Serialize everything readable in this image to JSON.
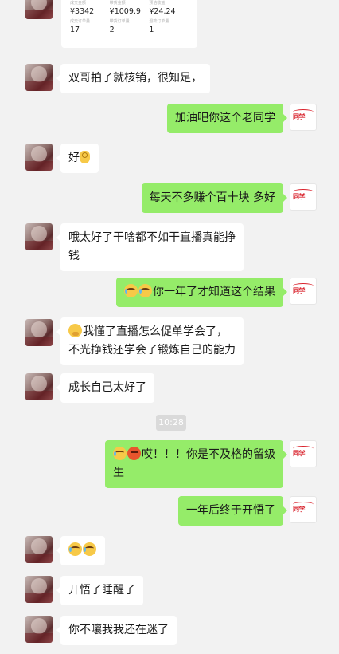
{
  "order_card": {
    "labels": [
      "成交金额",
      "带货金额",
      "预估收益"
    ],
    "values_top": [
      "¥3342",
      "¥1009.9",
      "¥24.24"
    ],
    "labels2": [
      "成交订单量",
      "带货订单量",
      "退款订单量"
    ],
    "values_bottom": [
      "17",
      "2",
      "1"
    ]
  },
  "messages": [
    {
      "side": "in",
      "lines": [
        "双哥拍了就核销，很知足，"
      ]
    },
    {
      "side": "out",
      "lines": [
        "加油吧你这个老同学"
      ]
    },
    {
      "side": "in",
      "lines": [
        "好"
      ],
      "emoji_after": "ok-hand-icon"
    },
    {
      "side": "out",
      "lines": [
        "每天不多赚个百十块 多好"
      ]
    },
    {
      "side": "in",
      "lines": [
        "哦太好了干啥都不如干直播真能挣",
        "钱"
      ]
    },
    {
      "side": "out",
      "lines": [
        "你一年了才知道这个结果"
      ],
      "emoji_before": [
        "laugh-cry-icon",
        "laugh-cry-icon"
      ]
    },
    {
      "side": "in",
      "lines": [
        "我懂了直播怎么促单学会了，",
        "不光挣钱还学会了锻炼自己的能力"
      ],
      "emoji_before": [
        "thinking-icon"
      ]
    },
    {
      "side": "in",
      "lines": [
        "成长自己太好了"
      ]
    },
    {
      "side": "time",
      "text": "10:28"
    },
    {
      "side": "out",
      "lines": [
        "哎！！！你是不及格的留级",
        "生"
      ],
      "emoji_before": [
        "laugh-cry-icon",
        "angry-icon"
      ]
    },
    {
      "side": "out",
      "lines": [
        "一年后终于开悟了"
      ]
    },
    {
      "side": "in",
      "lines": [
        ""
      ],
      "emoji_before": [
        "laugh-cry-icon",
        "laugh-cry-icon"
      ]
    },
    {
      "side": "in",
      "lines": [
        "开悟了睡醒了"
      ]
    },
    {
      "side": "in",
      "lines": [
        "你不嚷我我还在迷了"
      ]
    }
  ],
  "contact_avatar": {
    "logo_text": "同学"
  },
  "colors": {
    "background": "#f2f2f2",
    "outgoing_bubble": "#95ec69",
    "incoming_bubble": "#ffffff",
    "logo_red": "#d9232d"
  }
}
